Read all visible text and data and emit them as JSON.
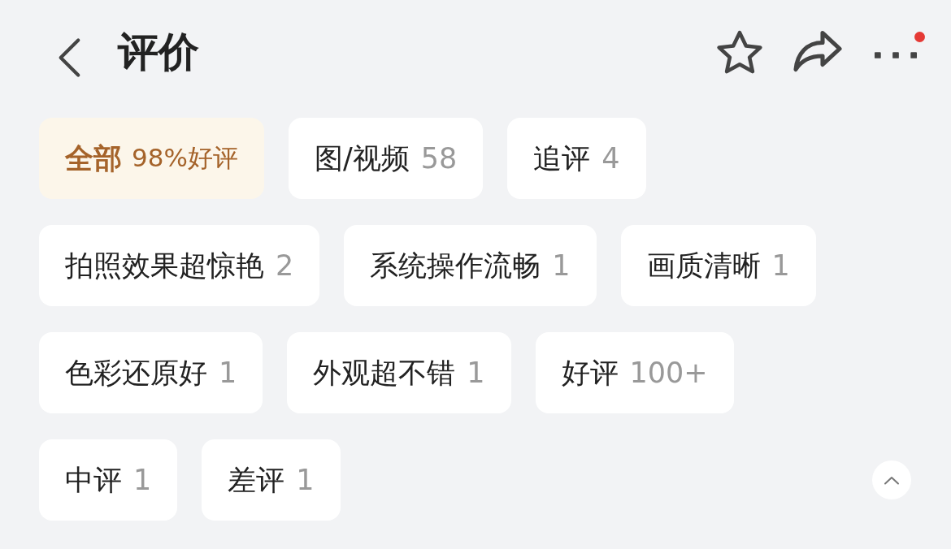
{
  "header": {
    "title": "评价",
    "more_badge": true
  },
  "filter_rows": [
    [
      {
        "label": "全部",
        "count": "98%好评",
        "selected": true
      },
      {
        "label": "图/视频",
        "count": "58",
        "selected": false
      },
      {
        "label": "追评",
        "count": "4",
        "selected": false
      }
    ],
    [
      {
        "label": "拍照效果超惊艳",
        "count": "2",
        "selected": false
      },
      {
        "label": "系统操作流畅",
        "count": "1",
        "selected": false
      },
      {
        "label": "画质清晰",
        "count": "1",
        "selected": false
      }
    ],
    [
      {
        "label": "色彩还原好",
        "count": "1",
        "selected": false
      },
      {
        "label": "外观超不错",
        "count": "1",
        "selected": false
      },
      {
        "label": "好评",
        "count": "100+",
        "selected": false
      }
    ],
    [
      {
        "label": "中评",
        "count": "1",
        "selected": false
      },
      {
        "label": "差评",
        "count": "1",
        "selected": false
      }
    ]
  ]
}
